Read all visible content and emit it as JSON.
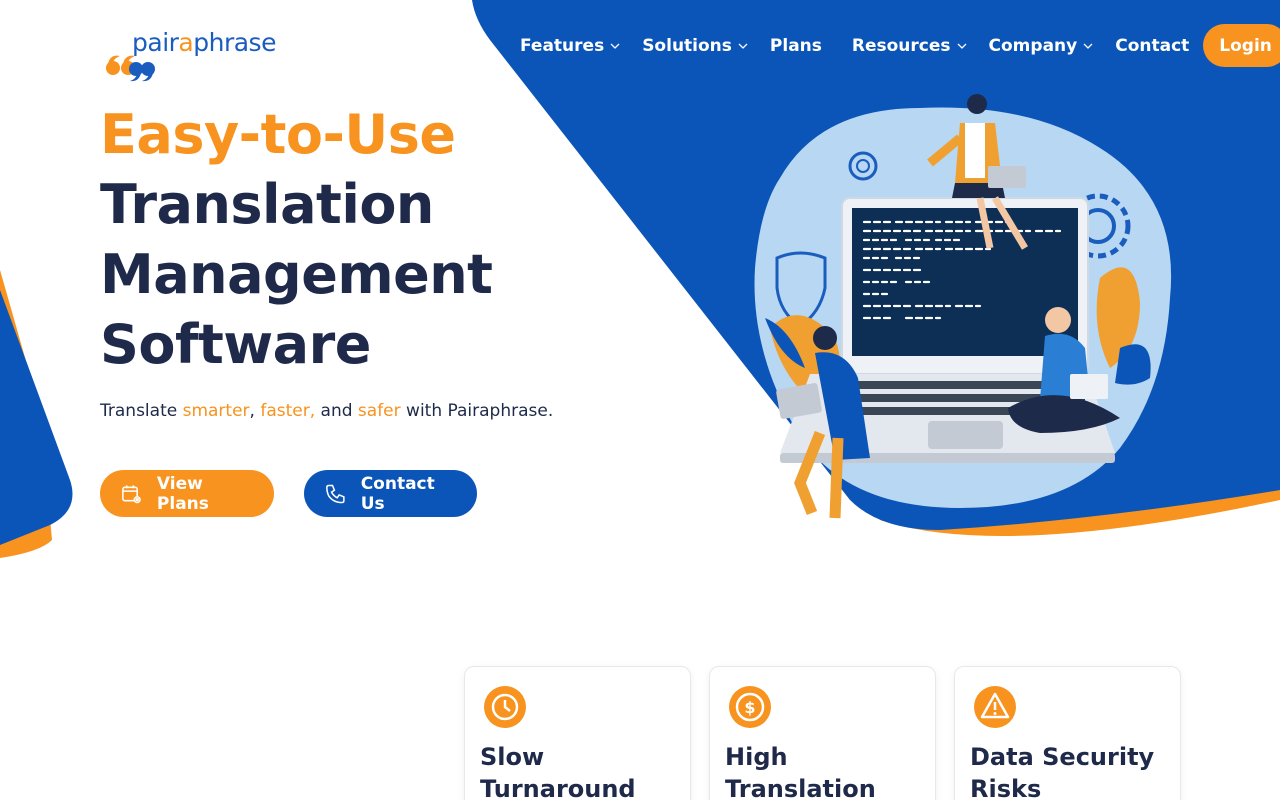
{
  "brand": {
    "name_prefix": "pair",
    "name_accent": "a",
    "name_suffix": "phrase",
    "colors": {
      "orange": "#f7931e",
      "blue": "#0c55b8",
      "navy": "#1f2a4a"
    }
  },
  "nav": {
    "items": [
      {
        "label": "Features",
        "has_dropdown": true
      },
      {
        "label": "Solutions",
        "has_dropdown": true
      },
      {
        "label": "Plans",
        "has_dropdown": false
      },
      {
        "label": "Resources",
        "has_dropdown": true
      },
      {
        "label": "Company",
        "has_dropdown": true
      },
      {
        "label": "Contact",
        "has_dropdown": false
      }
    ],
    "login_label": "Login"
  },
  "hero": {
    "headline_accent": "Easy-to-Use",
    "headline_lines": [
      "Translation",
      "Management",
      "Software"
    ],
    "tagline": {
      "pre": "Translate ",
      "w1": "smarter",
      "sep1": ", ",
      "w2": "faster,",
      "sep2": " and ",
      "w3": "safer",
      "post": " with Pairaphrase."
    },
    "buttons": {
      "plans_label": "View Plans",
      "plans_icon": "calendar-eye-icon",
      "contact_label": "Contact Us",
      "contact_icon": "phone-icon"
    }
  },
  "cards": [
    {
      "title": "Slow Turnaround",
      "icon": "clock-icon"
    },
    {
      "title": "High Translation Costs",
      "icon": "dollar-icon"
    },
    {
      "title": "Data Security Risks",
      "icon": "warning-icon"
    }
  ]
}
